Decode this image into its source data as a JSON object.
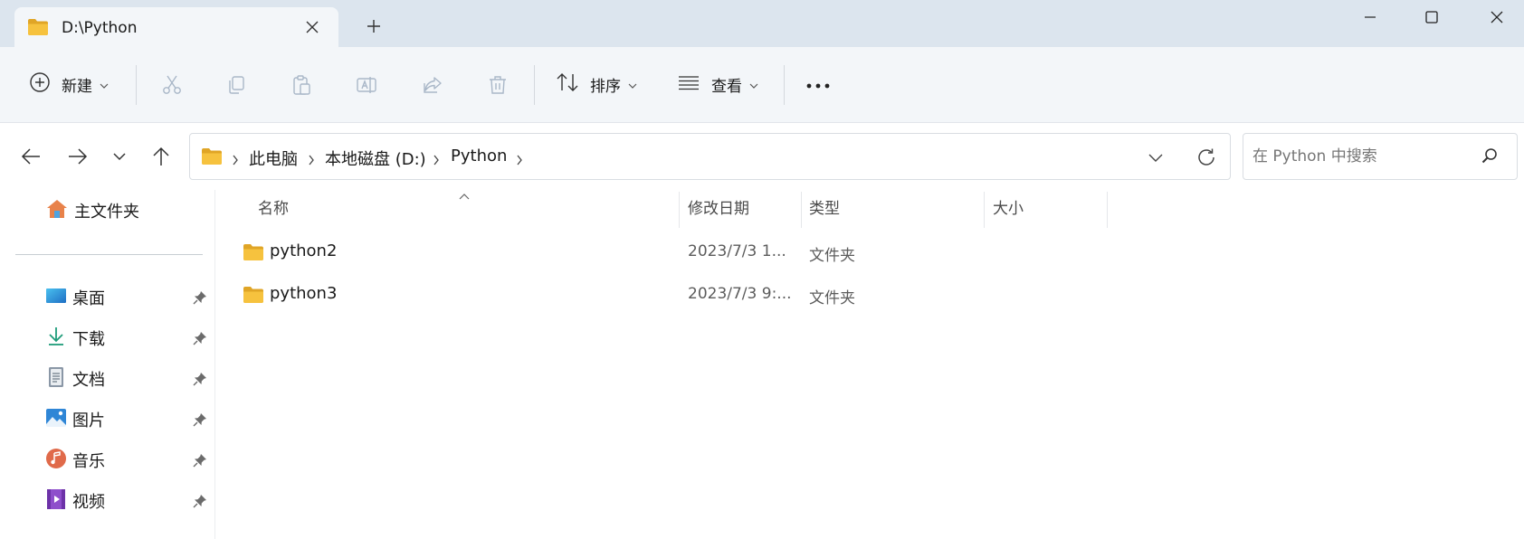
{
  "window": {
    "tab_title": "D:\\Python",
    "new_tab_glyph": "+",
    "icons": {
      "close_tab": "close-icon",
      "new_tab": "plus-icon",
      "minimize": "minimize-icon",
      "maximize": "maximize-icon",
      "close": "close-icon"
    }
  },
  "toolbar": {
    "new_label": "新建",
    "sort_label": "排序",
    "view_label": "查看",
    "more_glyph": "•••",
    "icons": [
      "cut-icon",
      "copy-icon",
      "paste-icon",
      "rename-icon",
      "share-icon",
      "delete-icon"
    ]
  },
  "address": {
    "breadcrumbs": [
      "此电脑",
      "本地磁盘 (D:)",
      "Python"
    ],
    "search_placeholder": "在 Python 中搜索"
  },
  "nav": {
    "home_label": "主文件夹",
    "items": [
      {
        "label": "桌面",
        "icon": "desktop-icon",
        "pinned": true
      },
      {
        "label": "下载",
        "icon": "download-icon",
        "pinned": true
      },
      {
        "label": "文档",
        "icon": "document-icon",
        "pinned": true
      },
      {
        "label": "图片",
        "icon": "pictures-icon",
        "pinned": true
      },
      {
        "label": "音乐",
        "icon": "music-icon",
        "pinned": true
      },
      {
        "label": "视频",
        "icon": "video-icon",
        "pinned": true
      }
    ]
  },
  "files": {
    "columns": [
      "名称",
      "修改日期",
      "类型",
      "大小"
    ],
    "rows": [
      {
        "name": "python2",
        "date": "2023/7/3 1...",
        "type": "文件夹",
        "size": ""
      },
      {
        "name": "python3",
        "date": "2023/7/3 9:...",
        "type": "文件夹",
        "size": ""
      }
    ]
  },
  "colors": {
    "titlebar": "#dce5ee",
    "tab_active": "#f3f6f9",
    "folder_yellow": "#f6c23e",
    "folder_dark": "#e0a526"
  }
}
